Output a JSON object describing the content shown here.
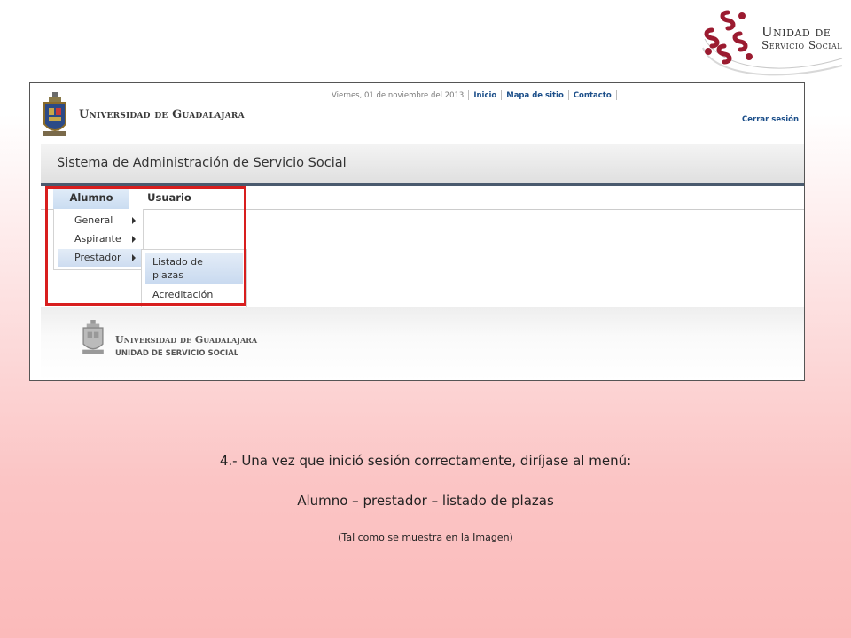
{
  "brand": {
    "line1": "Unidad de",
    "line2": "Servicio Social",
    "accent_color": "#9b1b30"
  },
  "screenshot": {
    "institution": "Universidad de Guadalajara",
    "date_text": "Viernes, 01 de noviembre del 2013",
    "top_links": [
      "Inicio",
      "Mapa de sitio",
      "Contacto"
    ],
    "logout_label": "Cerrar sesión",
    "system_title": "Sistema de Administración de Servicio Social",
    "menu": [
      {
        "label": "Alumno",
        "active": true
      },
      {
        "label": "Usuario",
        "active": false
      }
    ],
    "dropdown": [
      {
        "label": "General",
        "has_submenu": true,
        "highlighted": false
      },
      {
        "label": "Aspirante",
        "has_submenu": true,
        "highlighted": false
      },
      {
        "label": "Prestador",
        "has_submenu": true,
        "highlighted": true
      }
    ],
    "submenu": [
      {
        "label": "Listado de plazas",
        "highlighted": true
      },
      {
        "label": "Acreditación",
        "highlighted": false
      }
    ],
    "footer": {
      "title": "Universidad de Guadalajara",
      "subtitle": "UNIDAD DE SERVICIO SOCIAL"
    },
    "highlight_box_color": "#d81e1e",
    "nav_active_color": "#cadcf1",
    "sysbar_border_color": "#4a5a6e"
  },
  "instructions": {
    "line1": "4.- Una vez que inició sesión correctamente, diríjase al menú:",
    "line2": "Alumno – prestador – listado de plazas",
    "line3": "(Tal como se muestra en la Imagen)"
  }
}
